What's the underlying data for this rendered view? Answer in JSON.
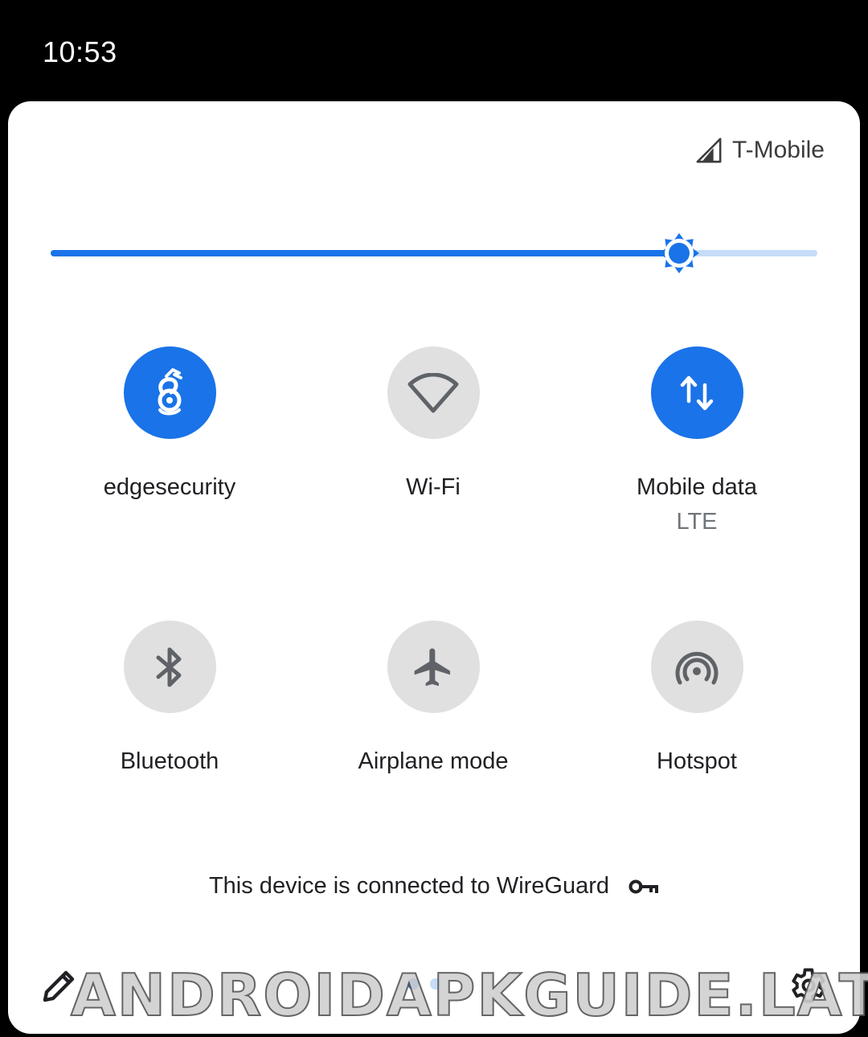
{
  "status_bar": {
    "time": "10:53"
  },
  "carrier": {
    "name": "T-Mobile",
    "icon": "cell-signal-icon"
  },
  "brightness": {
    "level": 0.82,
    "icon": "brightness-icon"
  },
  "tiles": [
    {
      "label": "edgesecurity",
      "sublabel": "",
      "state": "on",
      "icon": "wireguard-icon"
    },
    {
      "label": "Wi-Fi",
      "sublabel": "",
      "state": "off",
      "icon": "wifi-icon"
    },
    {
      "label": "Mobile data",
      "sublabel": "LTE",
      "state": "on",
      "icon": "mobile-data-icon"
    },
    {
      "label": "Bluetooth",
      "sublabel": "",
      "state": "off",
      "icon": "bluetooth-icon"
    },
    {
      "label": "Airplane mode",
      "sublabel": "",
      "state": "off",
      "icon": "airplane-icon"
    },
    {
      "label": "Hotspot",
      "sublabel": "",
      "state": "off",
      "icon": "hotspot-icon"
    }
  ],
  "vpn": {
    "text": "This device is connected to WireGuard",
    "icon": "vpn-key-icon"
  },
  "footer": {
    "pages": 2,
    "current_page": 1,
    "edit_icon": "pencil-icon",
    "settings_icon": "gear-icon"
  },
  "watermark": {
    "text": "ANDROIDAPKGUIDE.LAT"
  },
  "colors": {
    "accent": "#1a73e8",
    "accent_light": "#c6dcf8",
    "tile_off": "#e0e0e0",
    "icon_off": "#5f6368"
  }
}
